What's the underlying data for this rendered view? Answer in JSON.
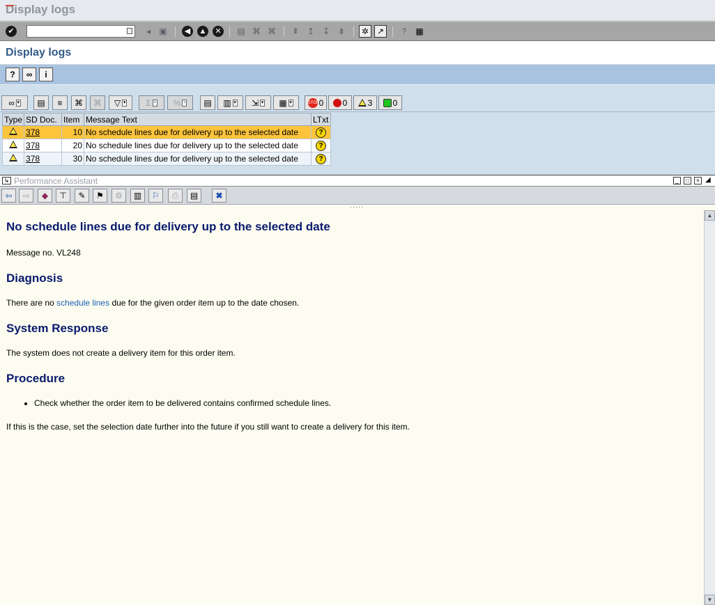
{
  "window": {
    "title": "Display logs"
  },
  "system_toolbar": {
    "command_value": ""
  },
  "screen": {
    "title": "Display logs"
  },
  "alv": {
    "counters": {
      "stop": "0",
      "error": "0",
      "warning": "3",
      "success": "0"
    },
    "columns": [
      "Type",
      "SD Doc.",
      "Item",
      "Message Text",
      "LTxt"
    ],
    "rows": [
      {
        "sd_doc": "378",
        "item": "10",
        "text": "No schedule lines due for delivery up to the selected date",
        "selected": true
      },
      {
        "sd_doc": "378",
        "item": "20",
        "text": "No schedule lines due for delivery up to the selected date",
        "selected": false
      },
      {
        "sd_doc": "378",
        "item": "30",
        "text": "No schedule lines due for delivery up to the selected date",
        "selected": false
      }
    ]
  },
  "assistant": {
    "title": "Performance Assistant"
  },
  "doc": {
    "title": "No schedule lines due for delivery up to the selected date",
    "message_no": "Message no. VL248",
    "diagnosis_heading": "Diagnosis",
    "diagnosis_pre": "There are no ",
    "diagnosis_link": "schedule lines",
    "diagnosis_post": " due for the given order item up to the date chosen.",
    "response_heading": "System Response",
    "response_text": "The system does not create a delivery item for this order item.",
    "procedure_heading": "Procedure",
    "procedure_bullet": "Check whether the order item to be delivered contains confirmed schedule lines.",
    "procedure_note": "If this is the case, set the selection date further into the future if you still want to create a delivery for this item."
  },
  "colors": {
    "selected_row": "#fdc43c",
    "app_toolbar": "#a9c4e0",
    "heading": "#0a1a6e",
    "link": "#1b60b7"
  }
}
